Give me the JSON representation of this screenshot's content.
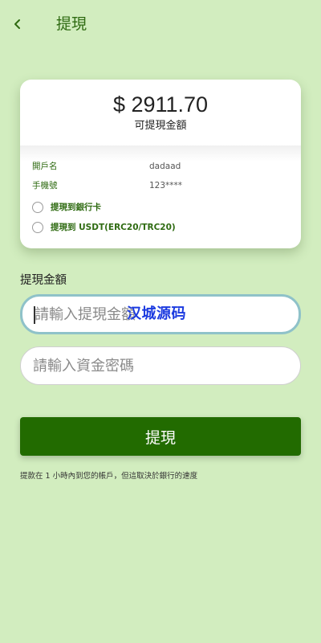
{
  "header": {
    "title": "提現"
  },
  "balance": {
    "amount": "$ 2911.70",
    "label": "可提現金額"
  },
  "account": {
    "name_label": "開戶名",
    "name_value": "dadaad",
    "phone_label": "手機號",
    "phone_value": "123****"
  },
  "withdraw_options": [
    {
      "label": "提現到銀行卡",
      "selected": false
    },
    {
      "label": "提現到 USDT(ERC20/TRC20)",
      "selected": false
    }
  ],
  "form": {
    "amount_section_label": "提現金額",
    "amount_placeholder": "請輸入提現金額",
    "password_placeholder": "請輸入資金密碼",
    "submit_label": "提現"
  },
  "watermark": "汉城源码",
  "note": "提款在 1 小時內到您的帳戶，但這取決於銀行的速度",
  "colors": {
    "background": "#d2edbf",
    "accent": "#226b00",
    "label_green": "#2f6b12",
    "focus_border": "#8fc2c9"
  },
  "icons": {
    "back": "chevron-left-icon"
  }
}
